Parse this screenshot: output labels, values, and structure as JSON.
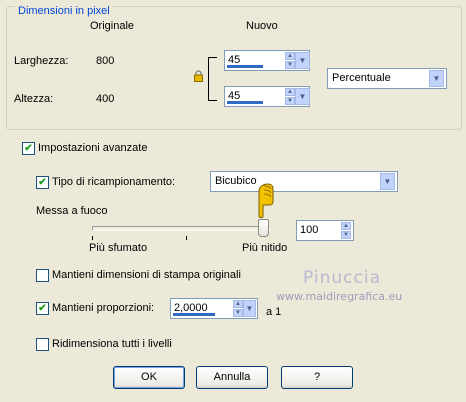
{
  "pixel_group": {
    "title": "Dimensioni in pixel",
    "col_original": "Originale",
    "col_new": "Nuovo",
    "width_label": "Larghezza:",
    "width_original": "800",
    "width_new": "45",
    "height_label": "Altezza:",
    "height_original": "400",
    "height_new": "45",
    "units": "Percentuale"
  },
  "advanced": {
    "label": "Impostazioni avanzate",
    "checked": true
  },
  "resample": {
    "label": "Tipo di ricampionamento:",
    "checked": true,
    "value": "Bicubico"
  },
  "sharpness": {
    "label": "Messa a fuoco",
    "left_label": "Più sfumato",
    "right_label": "Più nitido",
    "value": "100"
  },
  "keep_print": {
    "label": "Mantieni dimensioni di stampa originali",
    "checked": false
  },
  "keep_ratio": {
    "label": "Mantieni proporzioni:",
    "checked": true,
    "value": "2,0000",
    "suffix": "a 1"
  },
  "resize_all": {
    "label": "Ridimensiona tutti i livelli",
    "checked": false
  },
  "buttons": {
    "ok": "OK",
    "cancel": "Annulla",
    "help": "?"
  },
  "watermark": {
    "name": "Pinuccia",
    "url": "www.maidiregrafica.eu"
  },
  "colors": {
    "accent": "#316ac5",
    "title_blue": "#0046d5",
    "check_green": "#21a121",
    "hand_yellow": "#f2c200"
  }
}
